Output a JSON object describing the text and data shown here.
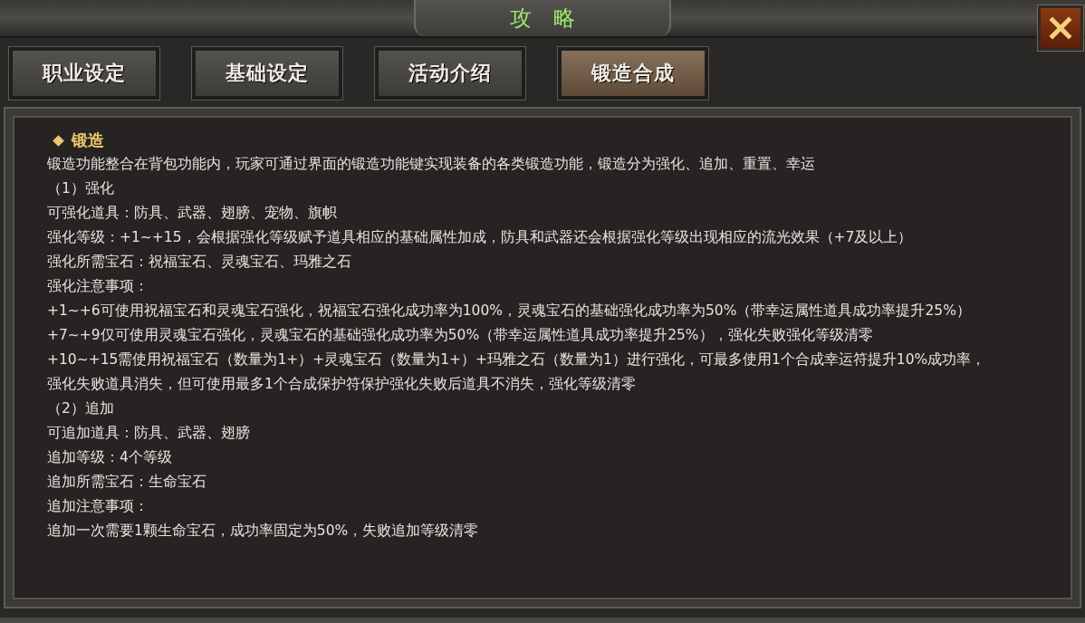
{
  "window": {
    "title": "攻　略"
  },
  "tabs": [
    {
      "label": "职业设定",
      "selected": false
    },
    {
      "label": "基础设定",
      "selected": false
    },
    {
      "label": "活动介绍",
      "selected": false
    },
    {
      "label": "锻造合成",
      "selected": true
    }
  ],
  "content": [
    {
      "kind": "heading",
      "text": "锻造"
    },
    {
      "kind": "text",
      "text": "锻造功能整合在背包功能内，玩家可通过界面的锻造功能键实现装备的各类锻造功能，锻造分为强化、追加、重置、幸运"
    },
    {
      "kind": "text",
      "text": "（1）强化"
    },
    {
      "kind": "text",
      "text": "可强化道具：防具、武器、翅膀、宠物、旗帜"
    },
    {
      "kind": "text",
      "text": "强化等级：+1~+15，会根据强化等级赋予道具相应的基础属性加成，防具和武器还会根据强化等级出现相应的流光效果（+7及以上）"
    },
    {
      "kind": "text",
      "text": "强化所需宝石：祝福宝石、灵魂宝石、玛雅之石"
    },
    {
      "kind": "text",
      "text": "强化注意事项："
    },
    {
      "kind": "text",
      "text": "+1~+6可使用祝福宝石和灵魂宝石强化，祝福宝石强化成功率为100%，灵魂宝石的基础强化成功率为50%（带幸运属性道具成功率提升25%）"
    },
    {
      "kind": "text",
      "text": "+7~+9仅可使用灵魂宝石强化，灵魂宝石的基础强化成功率为50%（带幸运属性道具成功率提升25%），强化失败强化等级清零"
    },
    {
      "kind": "text",
      "text": "+10~+15需使用祝福宝石（数量为1+）+灵魂宝石（数量为1+）+玛雅之石（数量为1）进行强化，可最多使用1个合成幸运符提升10%成功率，强化失败道具消失，但可使用最多1个合成保护符保护强化失败后道具不消失，强化等级清零"
    },
    {
      "kind": "text",
      "text": "（2）追加"
    },
    {
      "kind": "text",
      "text": "可追加道具：防具、武器、翅膀"
    },
    {
      "kind": "text",
      "text": "追加等级：4个等级"
    },
    {
      "kind": "text",
      "text": "追加所需宝石：生命宝石"
    },
    {
      "kind": "text",
      "text": "追加注意事项："
    },
    {
      "kind": "text",
      "text": "追加一次需要1颗生命宝石，成功率固定为50%，失败追加等级清零"
    }
  ]
}
